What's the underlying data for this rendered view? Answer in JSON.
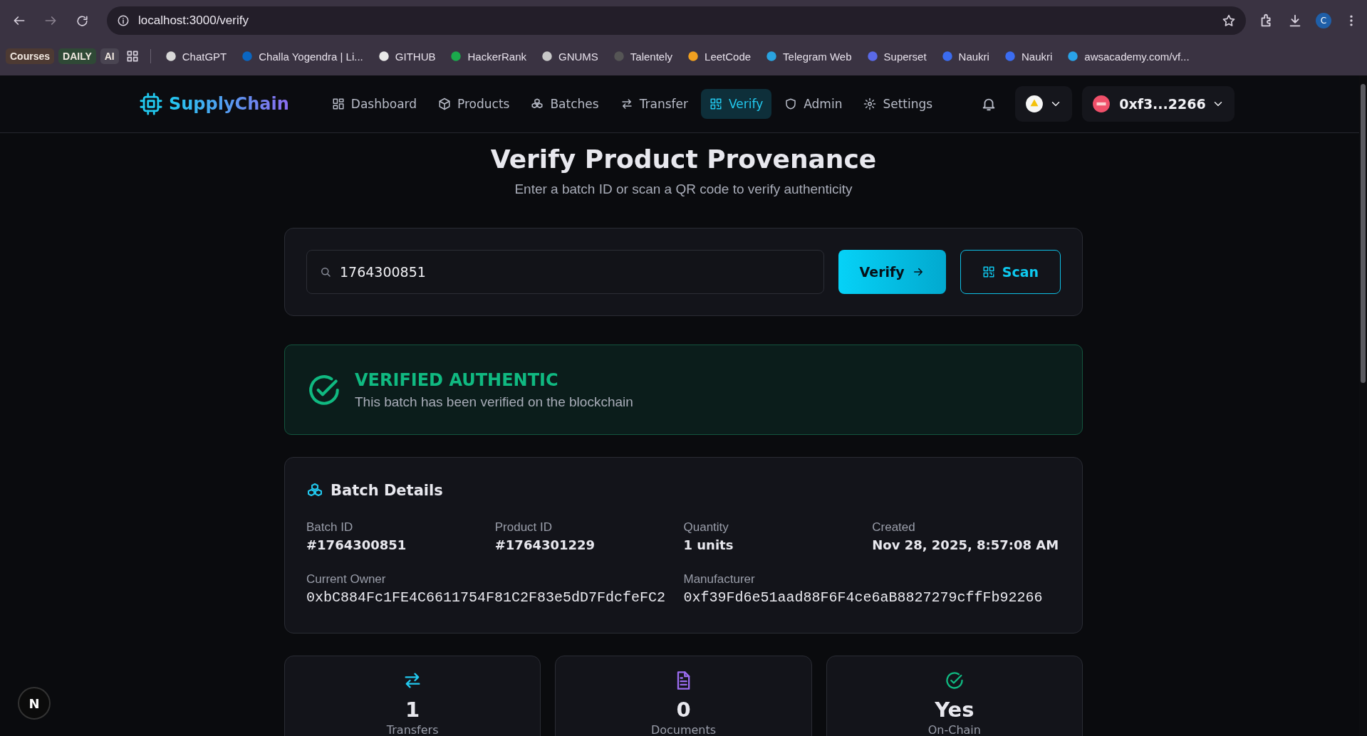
{
  "browser": {
    "url": "localhost:3000/verify",
    "profile_initial": "C",
    "bookmark_tags": [
      {
        "label": "Courses",
        "color": "#4d3a33"
      },
      {
        "label": "DAILY",
        "color": "#2f4936"
      },
      {
        "label": "AI",
        "color": "#4a4552"
      }
    ],
    "bookmarks": [
      "ChatGPT",
      "Challa Yogendra | Li...",
      "GITHUB",
      "HackerRank",
      "GNUMS",
      "Talentely",
      "LeetCode",
      "Telegram Web",
      "Superset",
      "Naukri",
      "Naukri",
      "awsacademy.com/vf..."
    ]
  },
  "app": {
    "brand": "SupplyChain",
    "account": "0xf3...2266",
    "nav": [
      {
        "label": "Dashboard",
        "kind": "dashboard",
        "selected": false
      },
      {
        "label": "Products",
        "kind": "products",
        "selected": false
      },
      {
        "label": "Batches",
        "kind": "batches",
        "selected": false
      },
      {
        "label": "Transfer",
        "kind": "transfer",
        "selected": false
      },
      {
        "label": "Verify",
        "kind": "verify",
        "selected": true
      },
      {
        "label": "Admin",
        "kind": "admin",
        "selected": false
      },
      {
        "label": "Settings",
        "kind": "settings",
        "selected": false
      }
    ]
  },
  "page": {
    "title": "Verify Product Provenance",
    "subtitle": "Enter a batch ID or scan a QR code to verify authenticity",
    "search": {
      "value": "1764300851"
    },
    "verify_button": "Verify",
    "scan_button": "Scan"
  },
  "result": {
    "verified": true,
    "status": "VERIFIED AUTHENTIC",
    "message": "This batch has been verified on the blockchain"
  },
  "batch": {
    "title": "Batch Details",
    "fields": [
      {
        "label": "Batch ID",
        "value": "#1764300851",
        "kind": "plain"
      },
      {
        "label": "Product ID",
        "value": "#1764301229",
        "kind": "plain"
      },
      {
        "label": "Quantity",
        "value": "1 units",
        "kind": "plain"
      },
      {
        "label": "Created",
        "value": "Nov 28, 2025, 8:57:08 AM",
        "kind": "plain"
      },
      {
        "label": "Current Owner",
        "value": "0xbC884Fc1FE4C6611754F81C2F83e5dD7FdcfeFC2",
        "kind": "address"
      },
      {
        "label": "Manufacturer",
        "value": "0xf39Fd6e51aad88F6F4ce6aB8827279cffFb92266",
        "kind": "address"
      }
    ]
  },
  "stats": [
    {
      "value": "1",
      "label": "Transfers",
      "kind": "transfers"
    },
    {
      "value": "0",
      "label": "Documents",
      "kind": "documents"
    },
    {
      "value": "Yes",
      "label": "On-Chain",
      "kind": "onchain"
    }
  ],
  "dev_badge": "N"
}
